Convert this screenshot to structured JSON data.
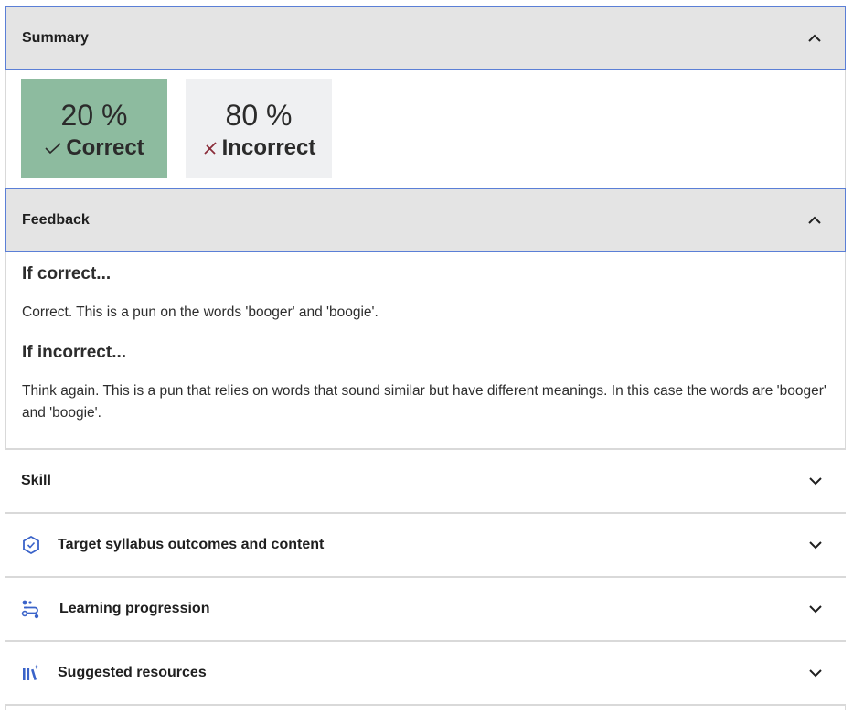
{
  "summary": {
    "title": "Summary",
    "correct": {
      "percent": "20 %",
      "label": "Correct",
      "color": "#8dbb9f"
    },
    "incorrect": {
      "percent": "80 %",
      "label": "Incorrect",
      "color": "#eff0f2"
    }
  },
  "feedback": {
    "title": "Feedback",
    "if_correct_heading": "If correct...",
    "if_correct_text": "Correct. This is a pun on the words 'booger' and 'boogie'.",
    "if_incorrect_heading": "If incorrect...",
    "if_incorrect_text": "Think again. This is a pun that relies on words that sound similar but have different meanings. In this case the words are 'booger' and 'boogie'."
  },
  "sections": [
    {
      "title": "Skill",
      "icon": ""
    },
    {
      "title": "Target syllabus outcomes and content",
      "icon": "hexagon-check-icon"
    },
    {
      "title": "Learning progression",
      "icon": "progression-icon"
    },
    {
      "title": "Suggested resources",
      "icon": "books-sparkle-icon"
    }
  ],
  "colors": {
    "accent": "#3a63c9",
    "open_header_bg": "#e4e4e4",
    "incorrect_icon": "#8a2c3a"
  }
}
